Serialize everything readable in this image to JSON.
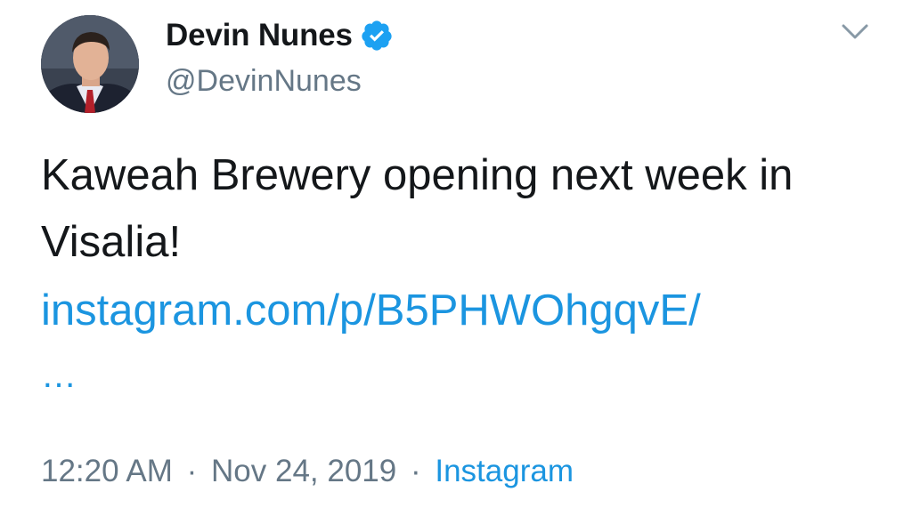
{
  "author": {
    "display_name": "Devin Nunes",
    "handle": "@DevinNunes",
    "verified": true,
    "avatar_icon": "profile-photo"
  },
  "tweet": {
    "text": "Kaweah Brewery opening next week in Visalia!",
    "link": "instagram.com/p/B5PHWOhgqvE/",
    "ellipsis": "…"
  },
  "meta": {
    "time": "12:20 AM",
    "separator": "·",
    "date": "Nov 24, 2019",
    "source": "Instagram"
  },
  "icons": {
    "verified": "verified-badge-icon",
    "menu": "chevron-down-icon"
  },
  "colors": {
    "text": "#14171a",
    "secondary": "#657786",
    "link": "#1b95e0",
    "verified": "#1da1f2"
  }
}
